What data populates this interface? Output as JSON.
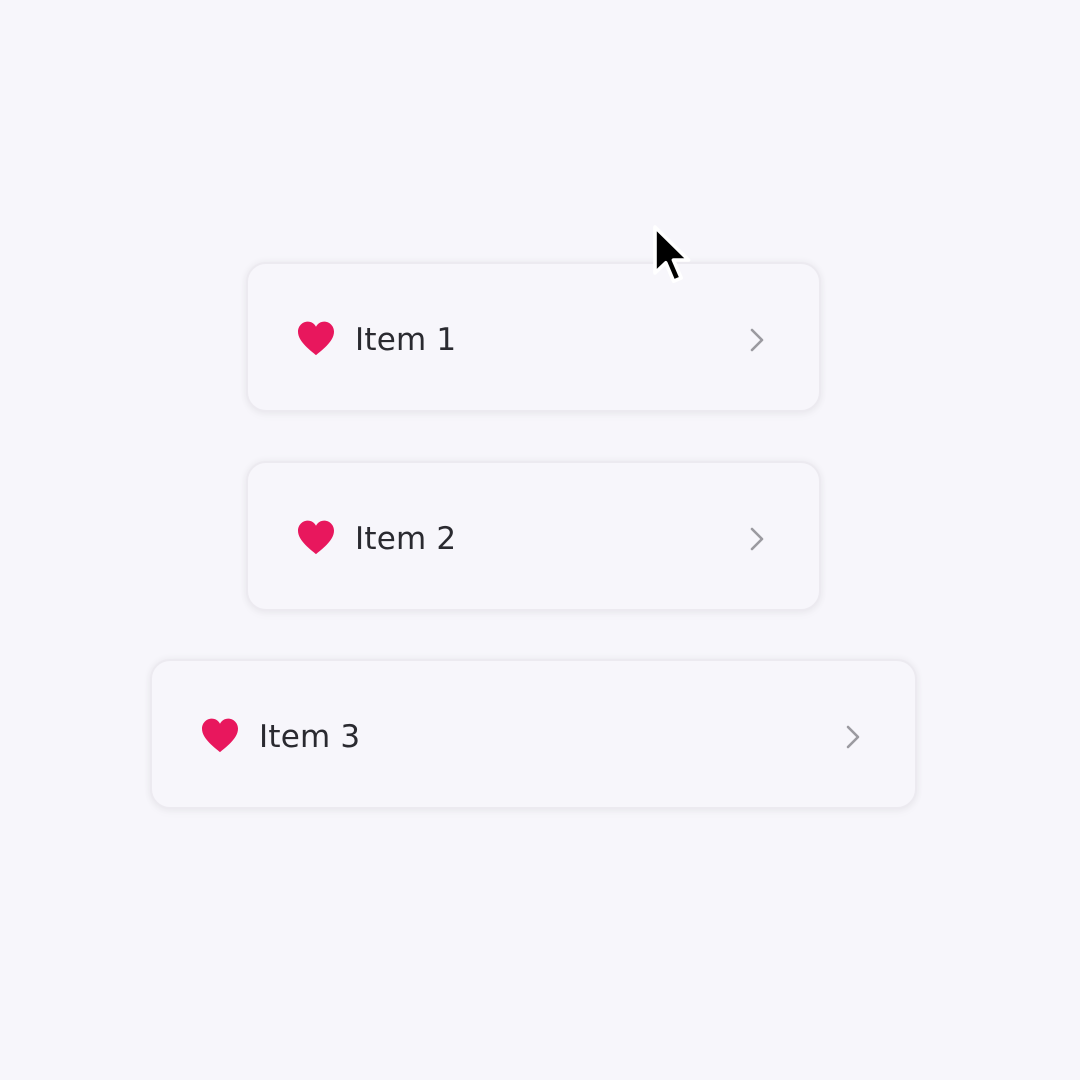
{
  "colors": {
    "background": "#f7f6fb",
    "heart": "#e8175d",
    "label": "#2a2a30",
    "chevron": "#9b9aa0"
  },
  "list": {
    "items": [
      {
        "label": "Item 1",
        "icon": "heart-icon",
        "trailing_icon": "chevron-right-icon"
      },
      {
        "label": "Item 2",
        "icon": "heart-icon",
        "trailing_icon": "chevron-right-icon"
      },
      {
        "label": "Item 3",
        "icon": "heart-icon",
        "trailing_icon": "chevron-right-icon"
      }
    ]
  },
  "pointer": {
    "icon": "mouse-cursor-icon"
  }
}
